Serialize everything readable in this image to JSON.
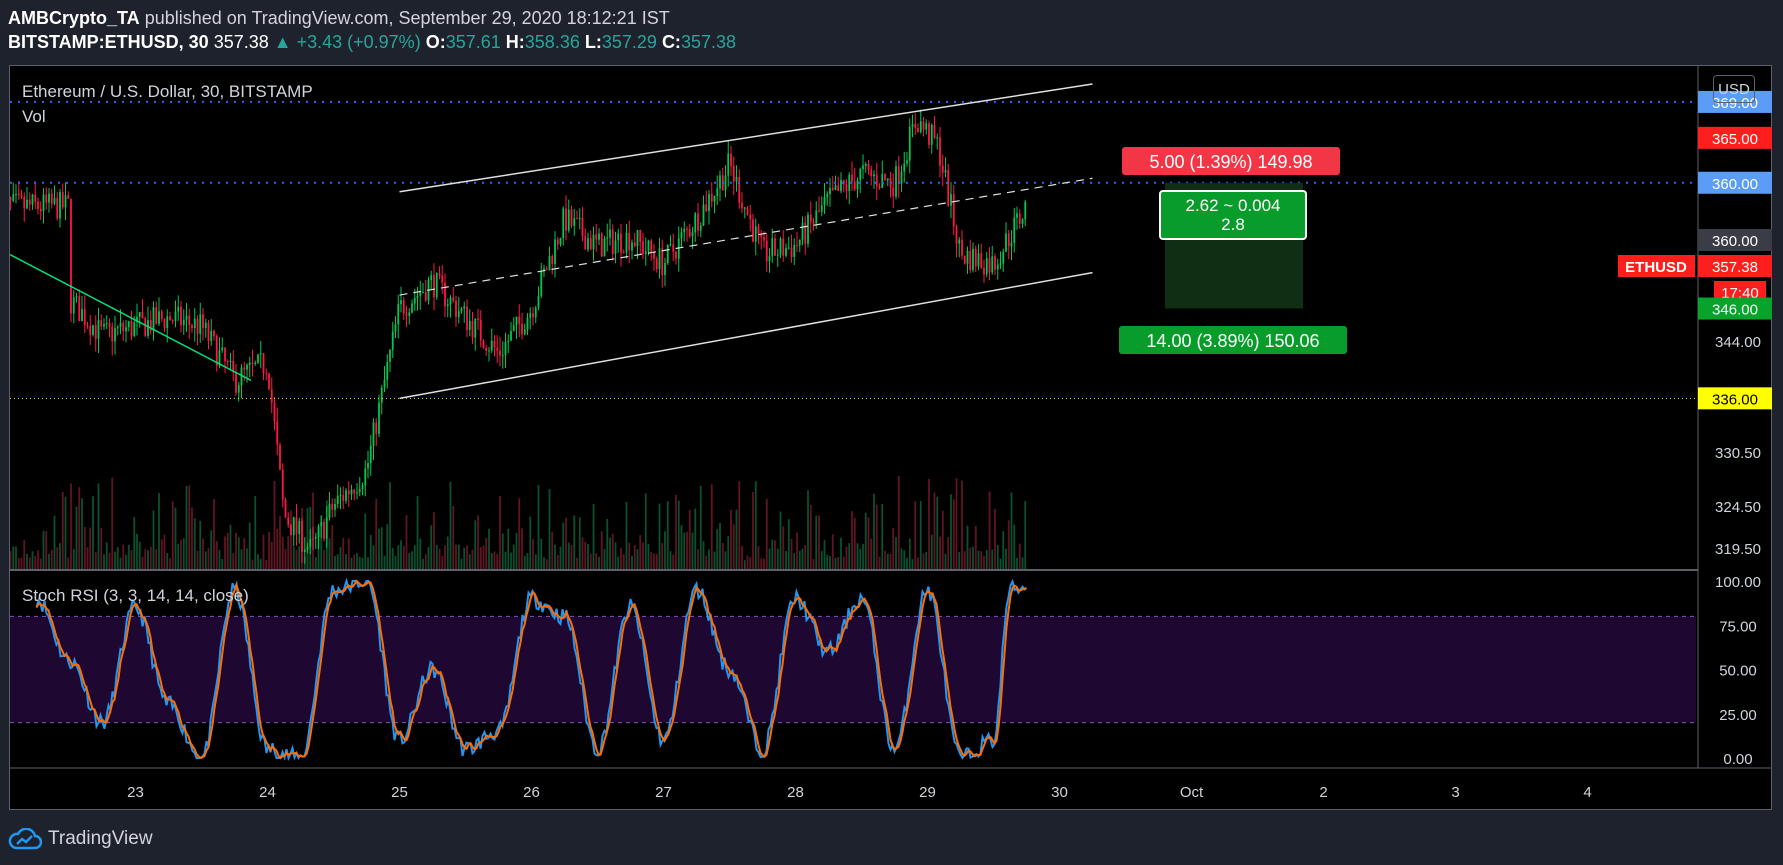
{
  "header": {
    "author": "AMBCrypto_TA",
    "published_text": "published on TradingView.com, September 29, 2020 18:12:21 IST",
    "symbol": "BITSTAMP:ETHUSD, 30",
    "last": "357.38",
    "change": "▲ +3.43 (+0.97%)",
    "o_label": "O:",
    "o_value": "357.61",
    "h_label": "H:",
    "h_value": "358.36",
    "l_label": "L:",
    "l_value": "357.29",
    "c_label": "C:",
    "c_value": "357.38"
  },
  "legend": {
    "title": "Ethereum / U.S. Dollar, 30, BITSTAMP",
    "vol": "Vol",
    "indicator": "Stoch RSI (3, 3, 14, 14, close)"
  },
  "currency_button": "USD",
  "brand": "TradingView",
  "colors": {
    "up": "#26a69a",
    "candle_up": "#00c853",
    "candle_down": "#ff1744",
    "level": "#2962ff",
    "support": "#f5e11b",
    "rsi_k": "#2196f3",
    "rsi_d": "#ff6d00",
    "rsi_band": "#1e0832",
    "trend": "#00e676"
  },
  "axis": {
    "price_ticks": [
      "319.50",
      "324.50",
      "330.50",
      "344.00",
      "360.00"
    ],
    "rsi_ticks": [
      "100.00",
      "75.00",
      "50.00",
      "25.00",
      "0.00"
    ],
    "date_ticks": [
      "23",
      "24",
      "25",
      "26",
      "27",
      "28",
      "29",
      "30",
      "Oct",
      "2",
      "3",
      "4"
    ]
  },
  "price_labels": [
    {
      "text": "369.00",
      "kind": "level"
    },
    {
      "text": "365.00",
      "kind": "stop"
    },
    {
      "text": "360.00",
      "kind": "level"
    },
    {
      "text": "357.38",
      "kind": "last"
    },
    {
      "text": "17:40",
      "kind": "timer"
    },
    {
      "text": "346.00",
      "kind": "target"
    },
    {
      "text": "336.00",
      "kind": "support"
    }
  ],
  "last_tag": "ETHUSD",
  "position_tool": {
    "stop_label": "5.00 (1.39%) 149.98",
    "ratio_line1": "2.62 ~ 0.004",
    "ratio_line2": "2.8",
    "target_label": "14.00 (3.89%) 150.06"
  },
  "chart_data": {
    "type": "candlestick",
    "symbol": "BITSTAMP:ETHUSD",
    "interval": "30",
    "x_range": [
      "2020-09-22",
      "2020-10-04"
    ],
    "y_range": [
      317,
      373
    ],
    "close_path": [
      {
        "x": "2020-09-22 12:00",
        "close": 347
      },
      {
        "x": "2020-09-22 18:00",
        "close": 343
      },
      {
        "x": "2020-09-23 00:00",
        "close": 344
      },
      {
        "x": "2020-09-23 06:00",
        "close": 345
      },
      {
        "x": "2020-09-23 12:00",
        "close": 344
      },
      {
        "x": "2020-09-23 18:00",
        "close": 338
      },
      {
        "x": "2020-09-24 00:00",
        "close": 340
      },
      {
        "x": "2020-09-24 03:00",
        "close": 323
      },
      {
        "x": "2020-09-24 08:00",
        "close": 319
      },
      {
        "x": "2020-09-24 12:00",
        "close": 324
      },
      {
        "x": "2020-09-24 18:00",
        "close": 328
      },
      {
        "x": "2020-09-25 00:00",
        "close": 346
      },
      {
        "x": "2020-09-25 06:00",
        "close": 349
      },
      {
        "x": "2020-09-25 12:00",
        "close": 345
      },
      {
        "x": "2020-09-25 18:00",
        "close": 341
      },
      {
        "x": "2020-09-26 00:00",
        "close": 346
      },
      {
        "x": "2020-09-26 06:00",
        "close": 356
      },
      {
        "x": "2020-09-26 12:00",
        "close": 353
      },
      {
        "x": "2020-09-26 18:00",
        "close": 354
      },
      {
        "x": "2020-09-27 00:00",
        "close": 351
      },
      {
        "x": "2020-09-27 06:00",
        "close": 356
      },
      {
        "x": "2020-09-27 12:00",
        "close": 362
      },
      {
        "x": "2020-09-27 18:00",
        "close": 352
      },
      {
        "x": "2020-09-28 00:00",
        "close": 353
      },
      {
        "x": "2020-09-28 06:00",
        "close": 358
      },
      {
        "x": "2020-09-28 12:00",
        "close": 361
      },
      {
        "x": "2020-09-28 18:00",
        "close": 360
      },
      {
        "x": "2020-09-28 22:00",
        "close": 367
      },
      {
        "x": "2020-09-29 02:00",
        "close": 364
      },
      {
        "x": "2020-09-29 06:00",
        "close": 352
      },
      {
        "x": "2020-09-29 12:00",
        "close": 351
      },
      {
        "x": "2020-09-29 18:00",
        "close": 357.38
      }
    ],
    "price_levels": [
      369.0,
      360.0,
      336.0
    ],
    "position": {
      "entry": 360.0,
      "stop": 365.0,
      "target": 346.0
    },
    "channel": {
      "upper": [
        {
          "x": "2020-09-25 00:00",
          "y": 359
        },
        {
          "x": "2020-09-30 06:00",
          "y": 371
        }
      ],
      "lower": [
        {
          "x": "2020-09-25 00:00",
          "y": 336
        },
        {
          "x": "2020-09-30 06:00",
          "y": 350
        }
      ]
    },
    "stoch_rsi": {
      "y_range": [
        0,
        100
      ],
      "bands": [
        20,
        80
      ],
      "k_path": [
        {
          "x": "2020-09-22 06:00",
          "v": 90
        },
        {
          "x": "2020-09-22 12:00",
          "v": 55
        },
        {
          "x": "2020-09-22 18:00",
          "v": 20
        },
        {
          "x": "2020-09-23 00:00",
          "v": 85
        },
        {
          "x": "2020-09-23 06:00",
          "v": 30
        },
        {
          "x": "2020-09-23 12:00",
          "v": 0
        },
        {
          "x": "2020-09-23 18:00",
          "v": 95
        },
        {
          "x": "2020-09-24 00:00",
          "v": 5
        },
        {
          "x": "2020-09-24 06:00",
          "v": 0
        },
        {
          "x": "2020-09-24 12:00",
          "v": 95
        },
        {
          "x": "2020-09-24 18:00",
          "v": 100
        },
        {
          "x": "2020-09-25 00:00",
          "v": 10
        },
        {
          "x": "2020-09-25 06:00",
          "v": 50
        },
        {
          "x": "2020-09-25 12:00",
          "v": 5
        },
        {
          "x": "2020-09-25 18:00",
          "v": 15
        },
        {
          "x": "2020-09-26 00:00",
          "v": 90
        },
        {
          "x": "2020-09-26 06:00",
          "v": 80
        },
        {
          "x": "2020-09-26 12:00",
          "v": 5
        },
        {
          "x": "2020-09-26 18:00",
          "v": 85
        },
        {
          "x": "2020-09-27 00:00",
          "v": 10
        },
        {
          "x": "2020-09-27 06:00",
          "v": 95
        },
        {
          "x": "2020-09-27 12:00",
          "v": 50
        },
        {
          "x": "2020-09-27 18:00",
          "v": 5
        },
        {
          "x": "2020-09-28 00:00",
          "v": 90
        },
        {
          "x": "2020-09-28 06:00",
          "v": 60
        },
        {
          "x": "2020-09-28 12:00",
          "v": 90
        },
        {
          "x": "2020-09-28 18:00",
          "v": 5
        },
        {
          "x": "2020-09-29 00:00",
          "v": 95
        },
        {
          "x": "2020-09-29 06:00",
          "v": 0
        },
        {
          "x": "2020-09-29 12:00",
          "v": 10
        },
        {
          "x": "2020-09-29 15:00",
          "v": 95
        },
        {
          "x": "2020-09-29 18:00",
          "v": 97
        }
      ]
    }
  }
}
